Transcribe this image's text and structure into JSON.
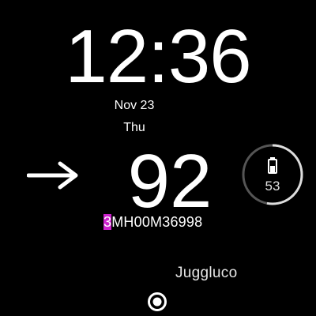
{
  "clock": {
    "time": "12:36",
    "date": "Nov 23",
    "weekday": "Thu"
  },
  "reading": {
    "trend_icon": "arrow-right-icon",
    "glucose": "92",
    "sensor_id_first": "3",
    "sensor_id_rest": "MH00M36998"
  },
  "battery": {
    "icon": "battery-icon",
    "level_text": "53",
    "level_fraction": 0.53
  },
  "app": {
    "name": "Juggluco"
  },
  "nav": {
    "home_icon": "home-button-icon"
  },
  "colors": {
    "background": "#000000",
    "text": "#ffffff",
    "highlight": "#cc22cc",
    "ring_track": "#555555",
    "ring_fill": "#dddddd"
  }
}
